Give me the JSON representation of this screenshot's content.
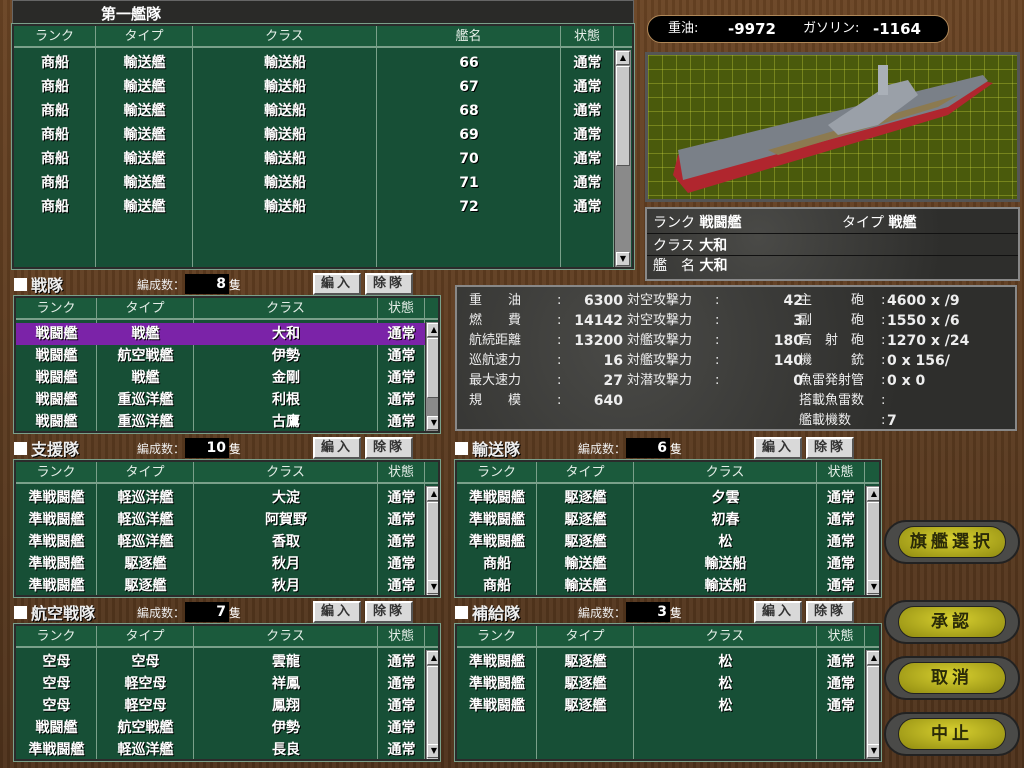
{
  "columns": {
    "rank": "ランク",
    "type": "タイプ",
    "class": "クラス",
    "name": "艦名",
    "status": "状態"
  },
  "count_label": "編成数：",
  "unit": "隻",
  "add_label": "編入",
  "remove_label": "除隊",
  "fleet1": {
    "title": "第一艦隊",
    "rows": [
      [
        "商船",
        "輸送艦",
        "輸送船",
        "66",
        "通常"
      ],
      [
        "商船",
        "輸送艦",
        "輸送船",
        "67",
        "通常"
      ],
      [
        "商船",
        "輸送艦",
        "輸送船",
        "68",
        "通常"
      ],
      [
        "商船",
        "輸送艦",
        "輸送船",
        "69",
        "通常"
      ],
      [
        "商船",
        "輸送艦",
        "輸送船",
        "70",
        "通常"
      ],
      [
        "商船",
        "輸送艦",
        "輸送船",
        "71",
        "通常"
      ],
      [
        "商船",
        "輸送艦",
        "輸送船",
        "72",
        "通常"
      ]
    ]
  },
  "resources": {
    "heavy_oil_label": "重油:",
    "heavy_oil": "-9972",
    "gasoline_label": "ガソリン:",
    "gasoline": "-1164"
  },
  "ship_info": {
    "rank_label": "ランク",
    "rank": "戦闘艦",
    "type_label": "タイプ",
    "type": "戦艦",
    "class_label": "クラス",
    "class": "大和",
    "name_label": "艦　名",
    "name": "大和"
  },
  "stats": {
    "col1": [
      [
        "重　　油",
        "6300"
      ],
      [
        "燃　　費",
        "14142"
      ],
      [
        "航続距離",
        "13200"
      ],
      [
        "巡航速力",
        "16"
      ],
      [
        "最大速力",
        "27"
      ],
      [
        "規　　模",
        "640"
      ]
    ],
    "col2": [
      [
        "対空攻撃力",
        "42"
      ],
      [
        "対空攻撃力",
        "3"
      ],
      [
        "対艦攻撃力",
        "180"
      ],
      [
        "対艦攻撃力",
        "140"
      ],
      [
        "対潜攻撃力",
        "0"
      ]
    ],
    "col3": [
      [
        "主　　　砲",
        "4600 x /9"
      ],
      [
        "副　　　砲",
        "1550 x /6"
      ],
      [
        "高　射　砲",
        "1270 x /24"
      ],
      [
        "機　　　銃",
        "0 x 156/"
      ],
      [
        "魚雷発射管",
        "0 x 0"
      ],
      [
        "搭載魚雷数",
        ""
      ],
      [
        "艦載機数",
        "7"
      ]
    ],
    "sep": ":"
  },
  "squadrons": [
    {
      "title": "戦隊",
      "count": "8",
      "selected": 0,
      "rows": [
        [
          "戦闘艦",
          "戦艦",
          "大和",
          "通常"
        ],
        [
          "戦闘艦",
          "航空戦艦",
          "伊勢",
          "通常"
        ],
        [
          "戦闘艦",
          "戦艦",
          "金剛",
          "通常"
        ],
        [
          "戦闘艦",
          "重巡洋艦",
          "利根",
          "通常"
        ],
        [
          "戦闘艦",
          "重巡洋艦",
          "古鷹",
          "通常"
        ]
      ]
    },
    {
      "title": "支援隊",
      "count": "10",
      "rows": [
        [
          "準戦闘艦",
          "軽巡洋艦",
          "大淀",
          "通常"
        ],
        [
          "準戦闘艦",
          "軽巡洋艦",
          "阿賀野",
          "通常"
        ],
        [
          "準戦闘艦",
          "軽巡洋艦",
          "香取",
          "通常"
        ],
        [
          "準戦闘艦",
          "駆逐艦",
          "秋月",
          "通常"
        ],
        [
          "準戦闘艦",
          "駆逐艦",
          "秋月",
          "通常"
        ]
      ]
    },
    {
      "title": "航空戦隊",
      "count": "7",
      "rows": [
        [
          "空母",
          "空母",
          "雲龍",
          "通常"
        ],
        [
          "空母",
          "軽空母",
          "祥鳳",
          "通常"
        ],
        [
          "空母",
          "軽空母",
          "鳳翔",
          "通常"
        ],
        [
          "戦闘艦",
          "航空戦艦",
          "伊勢",
          "通常"
        ],
        [
          "準戦闘艦",
          "軽巡洋艦",
          "長良",
          "通常"
        ]
      ]
    },
    {
      "title": "輸送隊",
      "count": "6",
      "rows": [
        [
          "準戦闘艦",
          "駆逐艦",
          "夕雲",
          "通常"
        ],
        [
          "準戦闘艦",
          "駆逐艦",
          "初春",
          "通常"
        ],
        [
          "準戦闘艦",
          "駆逐艦",
          "松",
          "通常"
        ],
        [
          "商船",
          "輸送艦",
          "輸送船",
          "通常"
        ],
        [
          "商船",
          "輸送艦",
          "輸送船",
          "通常"
        ]
      ]
    },
    {
      "title": "補給隊",
      "count": "3",
      "rows": [
        [
          "準戦闘艦",
          "駆逐艦",
          "松",
          "通常"
        ],
        [
          "準戦闘艦",
          "駆逐艦",
          "松",
          "通常"
        ],
        [
          "準戦闘艦",
          "駆逐艦",
          "松",
          "通常"
        ]
      ]
    }
  ],
  "buttons": {
    "flagship": "旗艦選択",
    "approve": "承認",
    "cancel": "取消",
    "abort": "中止"
  },
  "colors": {
    "table_green": "#174f36",
    "selected": "#7b23a8",
    "button_yellow": "#c8c020"
  }
}
